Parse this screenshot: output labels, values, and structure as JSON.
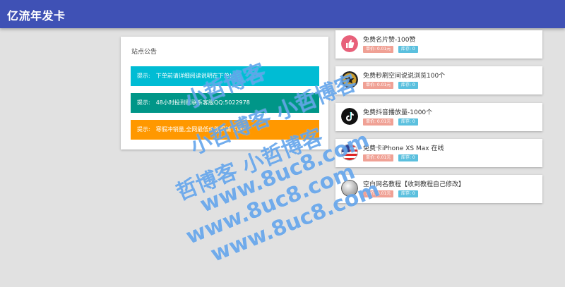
{
  "header": {
    "title": "亿流年发卡"
  },
  "notice": {
    "title": "站点公告",
    "alerts": [
      {
        "label": "提示:",
        "text": "下单前请详细阅读说明在下单!",
        "color": "#00bcd4"
      },
      {
        "label": "提示:",
        "text": "48小时投到账联系客服QQ:5022978",
        "color": "#009688"
      },
      {
        "label": "提示:",
        "text": "寒假冲销量,全网最低价购买请下单!",
        "color": "#ff9800"
      }
    ]
  },
  "products": [
    {
      "name": "免费名片赞-100赞",
      "price": "单价: 0.01元",
      "stock": "库存: 0",
      "icon": "thumbs-up-icon"
    },
    {
      "name": "免费秒刷空间说说浏览100个",
      "price": "单价: 0.01元",
      "stock": "库存: 0",
      "icon": "star-icon"
    },
    {
      "name": "免费抖音播放量-1000个",
      "price": "单价: 0.01元",
      "stock": "库存: 0",
      "icon": "tiktok-icon"
    },
    {
      "name": "免费卡iPhone XS Max 在线",
      "price": "单价: 0.01元",
      "stock": "库存: 0",
      "icon": "flag-icon"
    },
    {
      "name": "空白网名教程【收到教程自己修改】",
      "price": "单价: 0.01元",
      "stock": "库存: 0",
      "icon": "blank-circle-icon"
    }
  ],
  "watermark": {
    "lines": [
      "小哲博客",
      "小哲博客 小哲博客",
      "哲博客 小哲博客",
      "www.8uc8.com",
      "www.8uc8.com",
      "www.8uc8.com"
    ]
  },
  "colors": {
    "header": "#3f51b5",
    "price_badge": "#f0a195",
    "stock_badge": "#5bc0de"
  }
}
